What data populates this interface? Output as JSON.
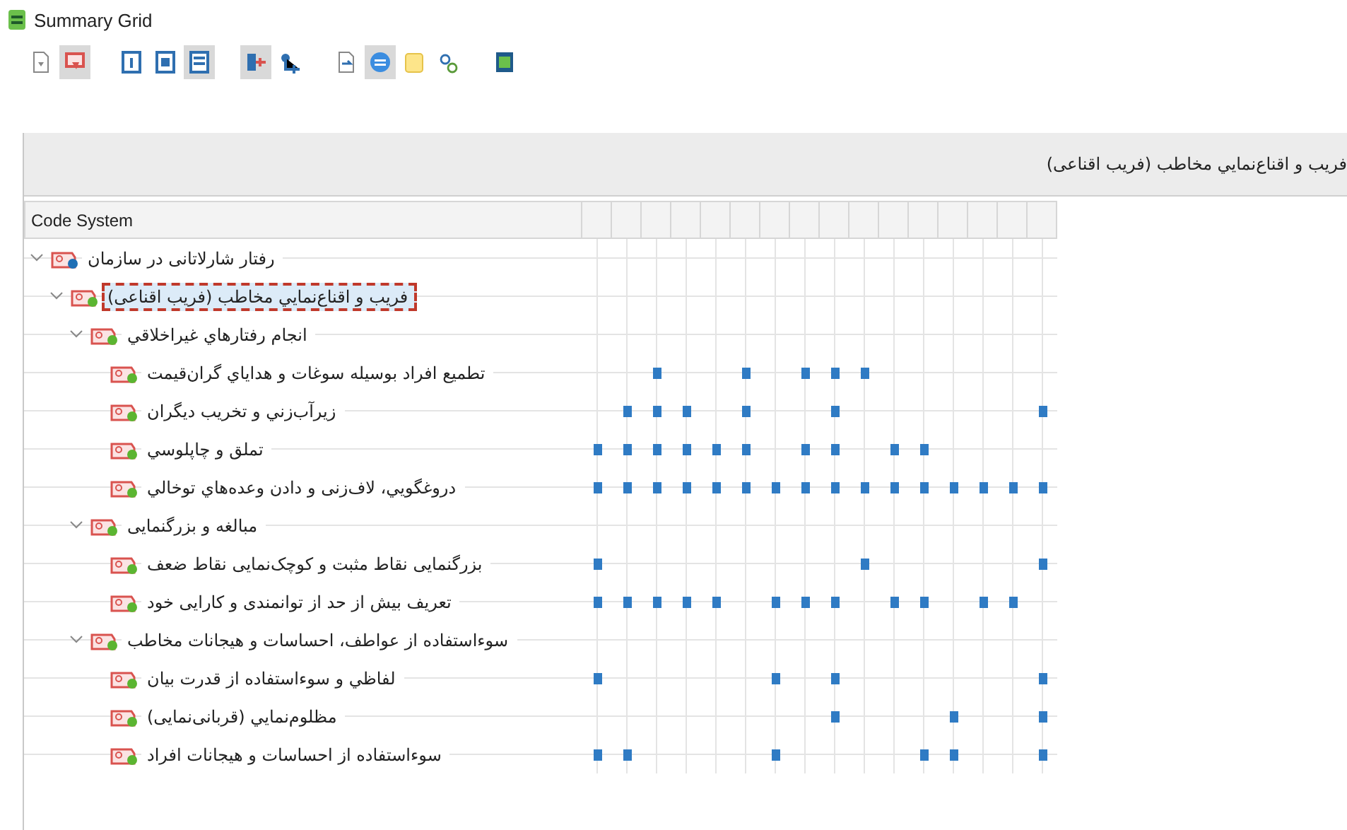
{
  "window": {
    "title": "Summary Grid"
  },
  "toolbar": [
    {
      "selected": false
    },
    {
      "selected": true
    },
    {
      "selected": false
    },
    {
      "selected": false
    },
    {
      "selected": true
    },
    {
      "selected": true
    },
    {
      "selected": false
    },
    {
      "selected": false
    },
    {
      "selected": true
    },
    {
      "selected": false
    },
    {
      "selected": false
    },
    {
      "selected": false
    }
  ],
  "header": {
    "title": "فريب و اقناع‌نمايي مخاطب (فريب اقناعی)"
  },
  "table": {
    "columns": [
      "Code System"
    ],
    "tree": [
      {
        "label": "رفتار شارلاتانی در سازمان",
        "color": "#1f6fb5",
        "expanded": true,
        "selected": false,
        "cells": [
          false,
          false,
          false,
          false,
          false,
          false,
          false,
          false,
          false,
          false,
          false,
          false,
          false,
          false,
          false,
          false
        ],
        "children": [
          {
            "label": "فريب و اقناع‌نمايي مخاطب (فريب اقناعی)",
            "color": "#5bb531",
            "expanded": true,
            "selected": true,
            "cells": [
              false,
              false,
              false,
              false,
              false,
              false,
              false,
              false,
              false,
              false,
              false,
              false,
              false,
              false,
              false,
              false
            ],
            "children": [
              {
                "label": "انجام رفتارهاي غيراخلاقي",
                "color": "#5bb531",
                "expanded": true,
                "selected": false,
                "cells": [
                  false,
                  false,
                  false,
                  false,
                  false,
                  false,
                  false,
                  false,
                  false,
                  false,
                  false,
                  false,
                  false,
                  false,
                  false,
                  false
                ],
                "children": [
                  {
                    "label": "تطميع افراد بوسيله سوغات و هداياي گران‌قيمت",
                    "color": "#5bb531",
                    "selected": false,
                    "cells": [
                      false,
                      false,
                      true,
                      false,
                      false,
                      true,
                      false,
                      true,
                      true,
                      true,
                      false,
                      false,
                      false,
                      false,
                      false,
                      false
                    ]
                  },
                  {
                    "label": "زيرآب‌زني و تخريب ديگران",
                    "color": "#5bb531",
                    "selected": false,
                    "cells": [
                      false,
                      true,
                      true,
                      true,
                      false,
                      true,
                      false,
                      false,
                      true,
                      false,
                      false,
                      false,
                      false,
                      false,
                      false,
                      true
                    ]
                  },
                  {
                    "label": "تملق و چاپلوسي",
                    "color": "#5bb531",
                    "selected": false,
                    "cells": [
                      true,
                      true,
                      true,
                      true,
                      true,
                      true,
                      false,
                      true,
                      true,
                      false,
                      true,
                      true,
                      false,
                      false,
                      false,
                      false
                    ]
                  },
                  {
                    "label": "دروغگويي، لاف‌زنی و دادن وعده‌هاي توخالي",
                    "color": "#5bb531",
                    "selected": false,
                    "cells": [
                      true,
                      true,
                      true,
                      true,
                      true,
                      true,
                      true,
                      true,
                      true,
                      true,
                      true,
                      true,
                      true,
                      true,
                      true,
                      true
                    ]
                  }
                ]
              },
              {
                "label": "مبالغه و بزرگنمايی",
                "color": "#5bb531",
                "expanded": true,
                "selected": false,
                "cells": [
                  false,
                  false,
                  false,
                  false,
                  false,
                  false,
                  false,
                  false,
                  false,
                  false,
                  false,
                  false,
                  false,
                  false,
                  false,
                  false
                ],
                "children": [
                  {
                    "label": "بزرگنمايی نقاط مثبت و کوچک‌نمايی نقاط ضعف",
                    "color": "#5bb531",
                    "selected": false,
                    "cells": [
                      true,
                      false,
                      false,
                      false,
                      false,
                      false,
                      false,
                      false,
                      false,
                      true,
                      false,
                      false,
                      false,
                      false,
                      false,
                      true
                    ]
                  },
                  {
                    "label": "تعريف بيش از حد از توانمندی و کارايی خود",
                    "color": "#5bb531",
                    "selected": false,
                    "cells": [
                      true,
                      true,
                      true,
                      true,
                      true,
                      false,
                      true,
                      true,
                      true,
                      false,
                      true,
                      true,
                      false,
                      true,
                      true,
                      false
                    ]
                  }
                ]
              },
              {
                "label": "سوءاستفاده از عواطف، احساسات و هيجانات مخاطب",
                "color": "#5bb531",
                "expanded": true,
                "selected": false,
                "cells": [
                  false,
                  false,
                  false,
                  false,
                  false,
                  false,
                  false,
                  false,
                  false,
                  false,
                  false,
                  false,
                  false,
                  false,
                  false,
                  false
                ],
                "children": [
                  {
                    "label": "لفاظي و سوءاستفاده از قدرت بيان",
                    "color": "#5bb531",
                    "selected": false,
                    "cells": [
                      true,
                      false,
                      false,
                      false,
                      false,
                      false,
                      true,
                      false,
                      true,
                      false,
                      false,
                      false,
                      false,
                      false,
                      false,
                      true
                    ]
                  },
                  {
                    "label": "مظلوم‌نمايي (قربانی‌نمايی)",
                    "color": "#5bb531",
                    "selected": false,
                    "cells": [
                      false,
                      false,
                      false,
                      false,
                      false,
                      false,
                      false,
                      false,
                      true,
                      false,
                      false,
                      false,
                      true,
                      false,
                      false,
                      true
                    ]
                  },
                  {
                    "label": "سوءاستفاده از احساسات و هيجانات افراد",
                    "color": "#5bb531",
                    "selected": false,
                    "cells": [
                      true,
                      true,
                      false,
                      false,
                      false,
                      false,
                      true,
                      false,
                      false,
                      false,
                      false,
                      true,
                      true,
                      false,
                      false,
                      true
                    ]
                  }
                ]
              }
            ]
          }
        ]
      }
    ]
  }
}
